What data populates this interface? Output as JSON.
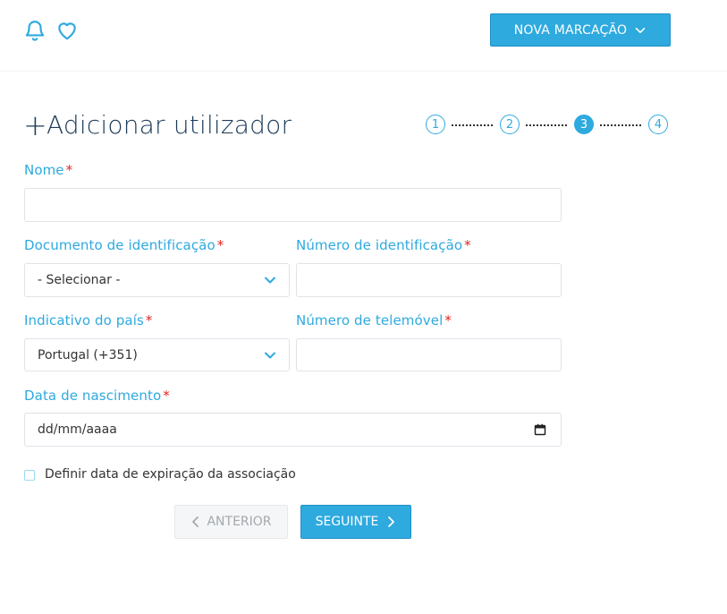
{
  "header": {
    "new_booking_label": "NOVA MARCAÇÃO",
    "icons": [
      "bell-icon",
      "heart-icon",
      "chevron-down-icon"
    ]
  },
  "form": {
    "title": "Adicionar utilizador",
    "steps": [
      "1",
      "2",
      "3",
      "4"
    ],
    "current_step": 3,
    "required_mark": "*",
    "name_label": "Nome",
    "name_value": "",
    "document_label": "Documento de identificação",
    "document_value": "- Selecionar -",
    "id_number_label": "Número de identificação",
    "id_number_value": "",
    "country_label": "Indicativo do país",
    "country_value": "Portugal (+351)",
    "phone_label": "Número de telemóvel",
    "phone_value": "",
    "birthdate_label": "Data de nascimento",
    "birthdate_placeholder": "dd/mm/aaaa",
    "expiry_checkbox_label": "Definir data de expiração da associação",
    "expiry_checked": false,
    "prev_label": "ANTERIOR",
    "next_label": "SEGUINTE"
  },
  "colors": {
    "accent": "#2eaadf",
    "title": "#1b3a57",
    "required": "#e02424",
    "disabled_text": "#a3a9ae"
  }
}
